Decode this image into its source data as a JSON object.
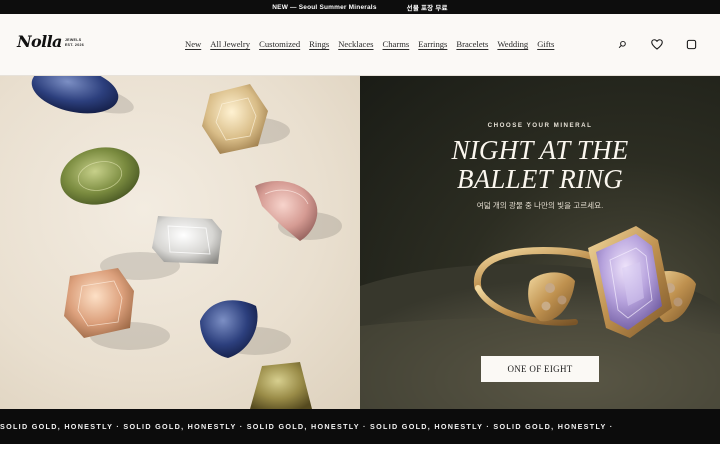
{
  "announcement": {
    "message": "NEW — Seoul Summer Minerals",
    "secondary": "선물 포장 무료"
  },
  "header": {
    "logo_word": "Nolla",
    "logo_sub_1": "JEWELS",
    "logo_sub_2": "EST. 2026",
    "nav": [
      "New",
      "All Jewelry",
      "Customized",
      "Rings",
      "Necklaces",
      "Charms",
      "Earrings",
      "Bracelets",
      "Wedding",
      "Gifts"
    ],
    "icons": [
      "search-icon",
      "heart-icon",
      "bag-icon"
    ]
  },
  "hero": {
    "eyebrow": "CHOOSE YOUR MINERAL",
    "title_line1": "NIGHT AT THE",
    "title_line2": "BALLET RING",
    "subtitle": "여덟 개의 광물 중 나만의 빛을 고르세요.",
    "cta_label": "ONE OF EIGHT"
  },
  "marquee": {
    "text": "SOLID GOLD, HONESTLY · SOLID GOLD, HONESTLY · SOLID GOLD, HONESTLY · SOLID GOLD, HONESTLY · SOLID GOLD, HONESTLY ·"
  },
  "colors": {
    "announcement_bg": "#0d0d0d",
    "header_bg": "#fbf9f6",
    "hero_right_bg": "#2c2d22",
    "cta_bg": "#fbf9f5",
    "marquee_bg": "#0c0c0c"
  }
}
